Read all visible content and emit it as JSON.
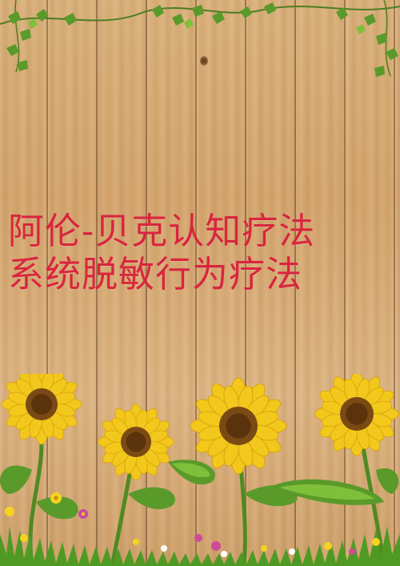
{
  "document": {
    "title_lines": [
      "阿伦-贝克认知疗法",
      "系统脱敏行为疗法"
    ]
  },
  "colors": {
    "title": "#d8263e",
    "wood": "#d4a46c",
    "leaf": "#5a9a2a",
    "petal": "#f2c81c",
    "flower_center": "#7a4a14"
  },
  "icons": [
    "ivy-vine-icon",
    "sunflower-icon",
    "grass-icon",
    "wildflower-icon"
  ]
}
